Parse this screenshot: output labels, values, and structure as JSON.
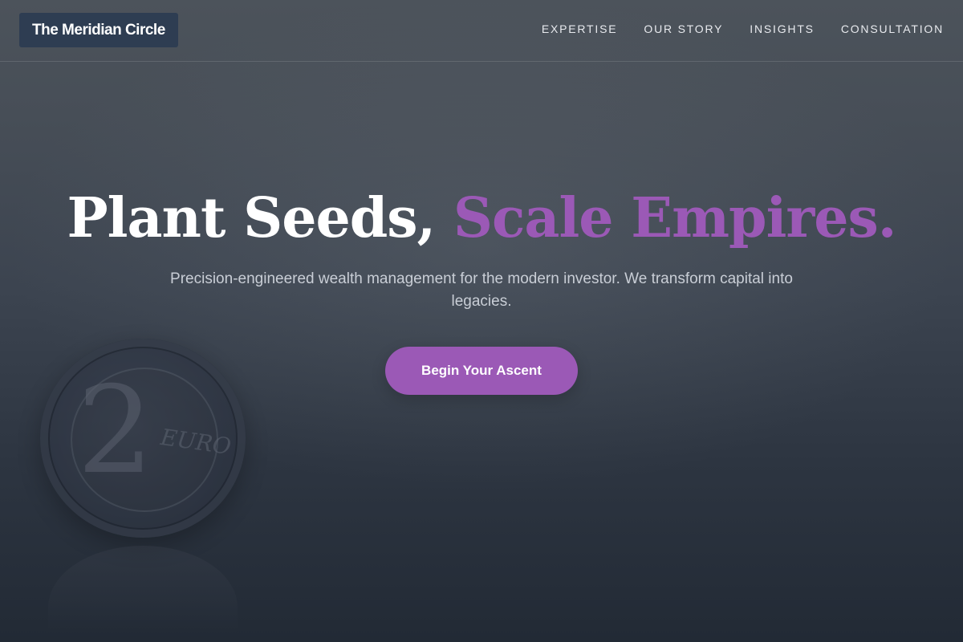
{
  "header": {
    "logo_text": "The Meridian Circle",
    "nav": [
      {
        "label": "EXPERTISE"
      },
      {
        "label": "OUR STORY"
      },
      {
        "label": "INSIGHTS"
      },
      {
        "label": "CONSULTATION"
      }
    ]
  },
  "hero": {
    "headline_white": "Plant Seeds, ",
    "headline_accent": "Scale Empires.",
    "subtitle": "Precision-engineered wealth management for the modern investor. We transform capital into legacies.",
    "cta_label": "Begin Your Ascent"
  },
  "background": {
    "coin_numeral": "2",
    "coin_text": "EURO"
  },
  "colors": {
    "accent": "#9b59b6",
    "logo_bg": "#2e3d52",
    "bg_top": "#4c535b",
    "bg_bottom": "#222a35",
    "subtitle": "#c9ced6"
  }
}
